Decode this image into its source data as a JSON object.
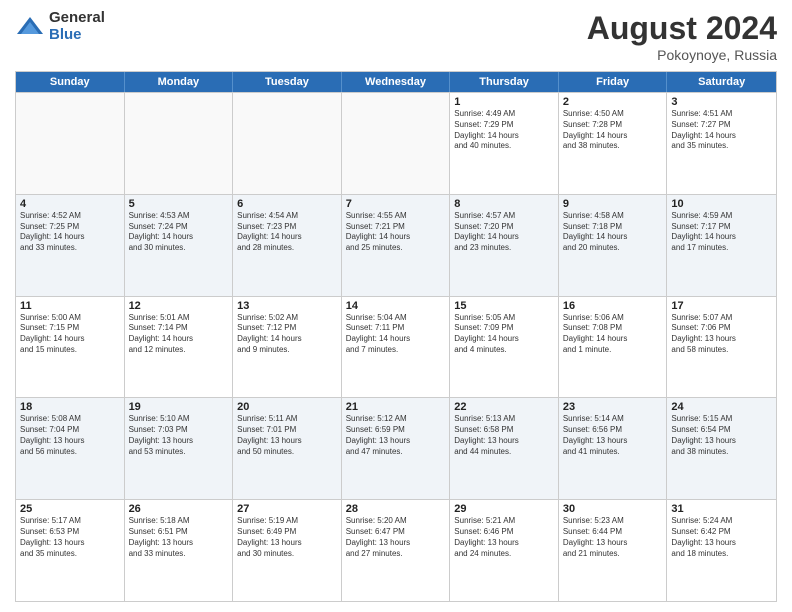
{
  "logo": {
    "general": "General",
    "blue": "Blue"
  },
  "title": {
    "month": "August 2024",
    "location": "Pokoynoye, Russia"
  },
  "header": {
    "days": [
      "Sunday",
      "Monday",
      "Tuesday",
      "Wednesday",
      "Thursday",
      "Friday",
      "Saturday"
    ]
  },
  "rows": [
    [
      {
        "day": "",
        "empty": true
      },
      {
        "day": "",
        "empty": true
      },
      {
        "day": "",
        "empty": true
      },
      {
        "day": "",
        "empty": true
      },
      {
        "day": "1",
        "lines": [
          "Sunrise: 4:49 AM",
          "Sunset: 7:29 PM",
          "Daylight: 14 hours",
          "and 40 minutes."
        ]
      },
      {
        "day": "2",
        "lines": [
          "Sunrise: 4:50 AM",
          "Sunset: 7:28 PM",
          "Daylight: 14 hours",
          "and 38 minutes."
        ]
      },
      {
        "day": "3",
        "lines": [
          "Sunrise: 4:51 AM",
          "Sunset: 7:27 PM",
          "Daylight: 14 hours",
          "and 35 minutes."
        ]
      }
    ],
    [
      {
        "day": "4",
        "lines": [
          "Sunrise: 4:52 AM",
          "Sunset: 7:25 PM",
          "Daylight: 14 hours",
          "and 33 minutes."
        ]
      },
      {
        "day": "5",
        "lines": [
          "Sunrise: 4:53 AM",
          "Sunset: 7:24 PM",
          "Daylight: 14 hours",
          "and 30 minutes."
        ]
      },
      {
        "day": "6",
        "lines": [
          "Sunrise: 4:54 AM",
          "Sunset: 7:23 PM",
          "Daylight: 14 hours",
          "and 28 minutes."
        ]
      },
      {
        "day": "7",
        "lines": [
          "Sunrise: 4:55 AM",
          "Sunset: 7:21 PM",
          "Daylight: 14 hours",
          "and 25 minutes."
        ]
      },
      {
        "day": "8",
        "lines": [
          "Sunrise: 4:57 AM",
          "Sunset: 7:20 PM",
          "Daylight: 14 hours",
          "and 23 minutes."
        ]
      },
      {
        "day": "9",
        "lines": [
          "Sunrise: 4:58 AM",
          "Sunset: 7:18 PM",
          "Daylight: 14 hours",
          "and 20 minutes."
        ]
      },
      {
        "day": "10",
        "lines": [
          "Sunrise: 4:59 AM",
          "Sunset: 7:17 PM",
          "Daylight: 14 hours",
          "and 17 minutes."
        ]
      }
    ],
    [
      {
        "day": "11",
        "lines": [
          "Sunrise: 5:00 AM",
          "Sunset: 7:15 PM",
          "Daylight: 14 hours",
          "and 15 minutes."
        ]
      },
      {
        "day": "12",
        "lines": [
          "Sunrise: 5:01 AM",
          "Sunset: 7:14 PM",
          "Daylight: 14 hours",
          "and 12 minutes."
        ]
      },
      {
        "day": "13",
        "lines": [
          "Sunrise: 5:02 AM",
          "Sunset: 7:12 PM",
          "Daylight: 14 hours",
          "and 9 minutes."
        ]
      },
      {
        "day": "14",
        "lines": [
          "Sunrise: 5:04 AM",
          "Sunset: 7:11 PM",
          "Daylight: 14 hours",
          "and 7 minutes."
        ]
      },
      {
        "day": "15",
        "lines": [
          "Sunrise: 5:05 AM",
          "Sunset: 7:09 PM",
          "Daylight: 14 hours",
          "and 4 minutes."
        ]
      },
      {
        "day": "16",
        "lines": [
          "Sunrise: 5:06 AM",
          "Sunset: 7:08 PM",
          "Daylight: 14 hours",
          "and 1 minute."
        ]
      },
      {
        "day": "17",
        "lines": [
          "Sunrise: 5:07 AM",
          "Sunset: 7:06 PM",
          "Daylight: 13 hours",
          "and 58 minutes."
        ]
      }
    ],
    [
      {
        "day": "18",
        "lines": [
          "Sunrise: 5:08 AM",
          "Sunset: 7:04 PM",
          "Daylight: 13 hours",
          "and 56 minutes."
        ]
      },
      {
        "day": "19",
        "lines": [
          "Sunrise: 5:10 AM",
          "Sunset: 7:03 PM",
          "Daylight: 13 hours",
          "and 53 minutes."
        ]
      },
      {
        "day": "20",
        "lines": [
          "Sunrise: 5:11 AM",
          "Sunset: 7:01 PM",
          "Daylight: 13 hours",
          "and 50 minutes."
        ]
      },
      {
        "day": "21",
        "lines": [
          "Sunrise: 5:12 AM",
          "Sunset: 6:59 PM",
          "Daylight: 13 hours",
          "and 47 minutes."
        ]
      },
      {
        "day": "22",
        "lines": [
          "Sunrise: 5:13 AM",
          "Sunset: 6:58 PM",
          "Daylight: 13 hours",
          "and 44 minutes."
        ]
      },
      {
        "day": "23",
        "lines": [
          "Sunrise: 5:14 AM",
          "Sunset: 6:56 PM",
          "Daylight: 13 hours",
          "and 41 minutes."
        ]
      },
      {
        "day": "24",
        "lines": [
          "Sunrise: 5:15 AM",
          "Sunset: 6:54 PM",
          "Daylight: 13 hours",
          "and 38 minutes."
        ]
      }
    ],
    [
      {
        "day": "25",
        "lines": [
          "Sunrise: 5:17 AM",
          "Sunset: 6:53 PM",
          "Daylight: 13 hours",
          "and 35 minutes."
        ]
      },
      {
        "day": "26",
        "lines": [
          "Sunrise: 5:18 AM",
          "Sunset: 6:51 PM",
          "Daylight: 13 hours",
          "and 33 minutes."
        ]
      },
      {
        "day": "27",
        "lines": [
          "Sunrise: 5:19 AM",
          "Sunset: 6:49 PM",
          "Daylight: 13 hours",
          "and 30 minutes."
        ]
      },
      {
        "day": "28",
        "lines": [
          "Sunrise: 5:20 AM",
          "Sunset: 6:47 PM",
          "Daylight: 13 hours",
          "and 27 minutes."
        ]
      },
      {
        "day": "29",
        "lines": [
          "Sunrise: 5:21 AM",
          "Sunset: 6:46 PM",
          "Daylight: 13 hours",
          "and 24 minutes."
        ]
      },
      {
        "day": "30",
        "lines": [
          "Sunrise: 5:23 AM",
          "Sunset: 6:44 PM",
          "Daylight: 13 hours",
          "and 21 minutes."
        ]
      },
      {
        "day": "31",
        "lines": [
          "Sunrise: 5:24 AM",
          "Sunset: 6:42 PM",
          "Daylight: 13 hours",
          "and 18 minutes."
        ]
      }
    ]
  ]
}
